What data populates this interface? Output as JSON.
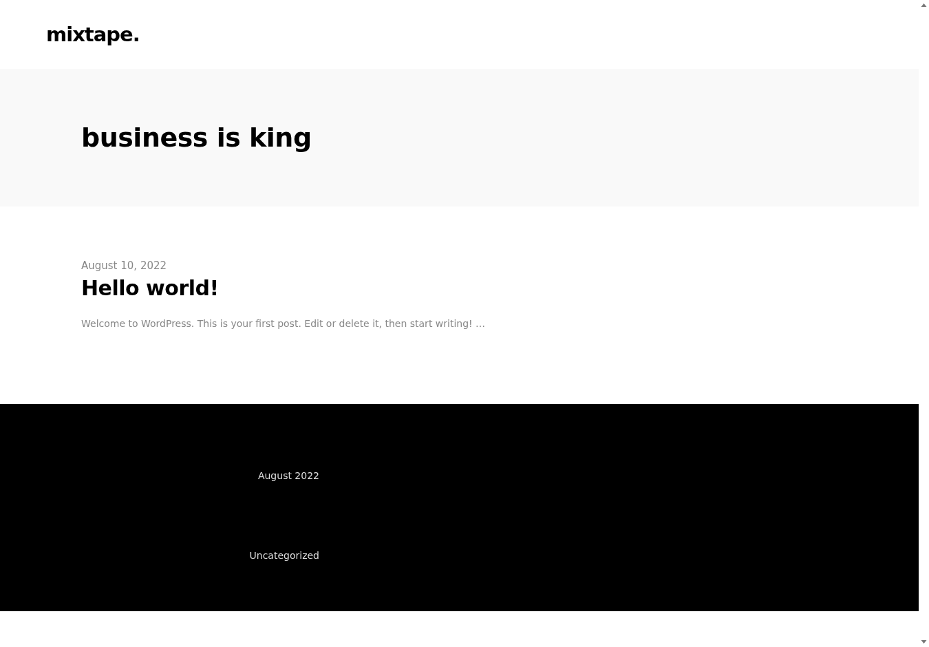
{
  "header": {
    "logo": "mixtape."
  },
  "archive": {
    "title": "business is king"
  },
  "posts": [
    {
      "date": "August 10, 2022",
      "title": "Hello world!",
      "excerpt": "Welcome to WordPress. This is your first post. Edit or delete it, then start writing! …"
    }
  ],
  "footer": {
    "links": [
      "August 2022",
      "Uncategorized"
    ]
  }
}
